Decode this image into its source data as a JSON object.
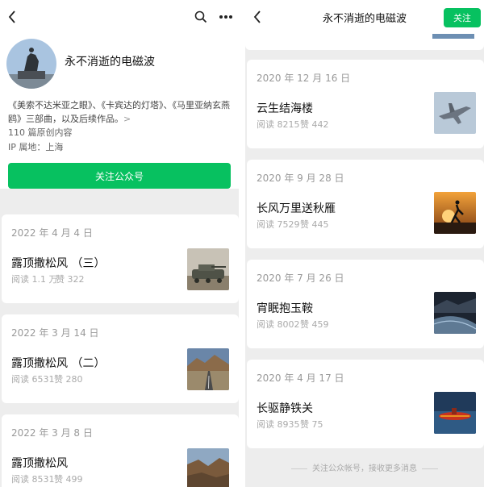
{
  "left": {
    "account_name": "永不消逝的电磁波",
    "intro": "《美索不达米亚之眼》、《卡宾达的灯塔》、《马里亚纳玄燕鸥》三部曲，以及后续作品。",
    "intro_more": ">",
    "original_count": "110 篇原创内容",
    "ip_location": "IP 属地：上海",
    "follow_button": "关注公众号",
    "articles": [
      {
        "date": "2022 年 4 月 4 日",
        "title": "露顶撒松风 （三）",
        "reads": "阅读 1.1 万",
        "likes": "赞 322"
      },
      {
        "date": "2022 年 3 月 14 日",
        "title": "露顶撒松风 （二）",
        "reads": "阅读 6531",
        "likes": "赞 280"
      },
      {
        "date": "2022 年 3 月 8 日",
        "title": "露顶撒松风",
        "reads": "阅读 8531",
        "likes": "赞 499"
      }
    ]
  },
  "right": {
    "header_title": "永不消逝的电磁波",
    "follow_button": "关注",
    "articles": [
      {
        "date": "2020 年 12 月 16 日",
        "title": "云生结海楼",
        "reads": "阅读 8215",
        "likes": "赞 442"
      },
      {
        "date": "2020 年 9 月 28 日",
        "title": "长风万里送秋雁",
        "reads": "阅读 7529",
        "likes": "赞 445"
      },
      {
        "date": "2020 年 7 月 26 日",
        "title": "宵眠抱玉鞍",
        "reads": "阅读 8002",
        "likes": "赞 459"
      },
      {
        "date": "2020 年 4 月 17 日",
        "title": "长驱静铁关",
        "reads": "阅读 8935",
        "likes": "赞 75"
      }
    ],
    "footer": "关注公众帐号，接收更多消息"
  },
  "colors": {
    "accent": "#07c160",
    "background": "#ededed"
  },
  "icons": [
    "back-arrow-icon",
    "search-icon",
    "more-icon"
  ]
}
